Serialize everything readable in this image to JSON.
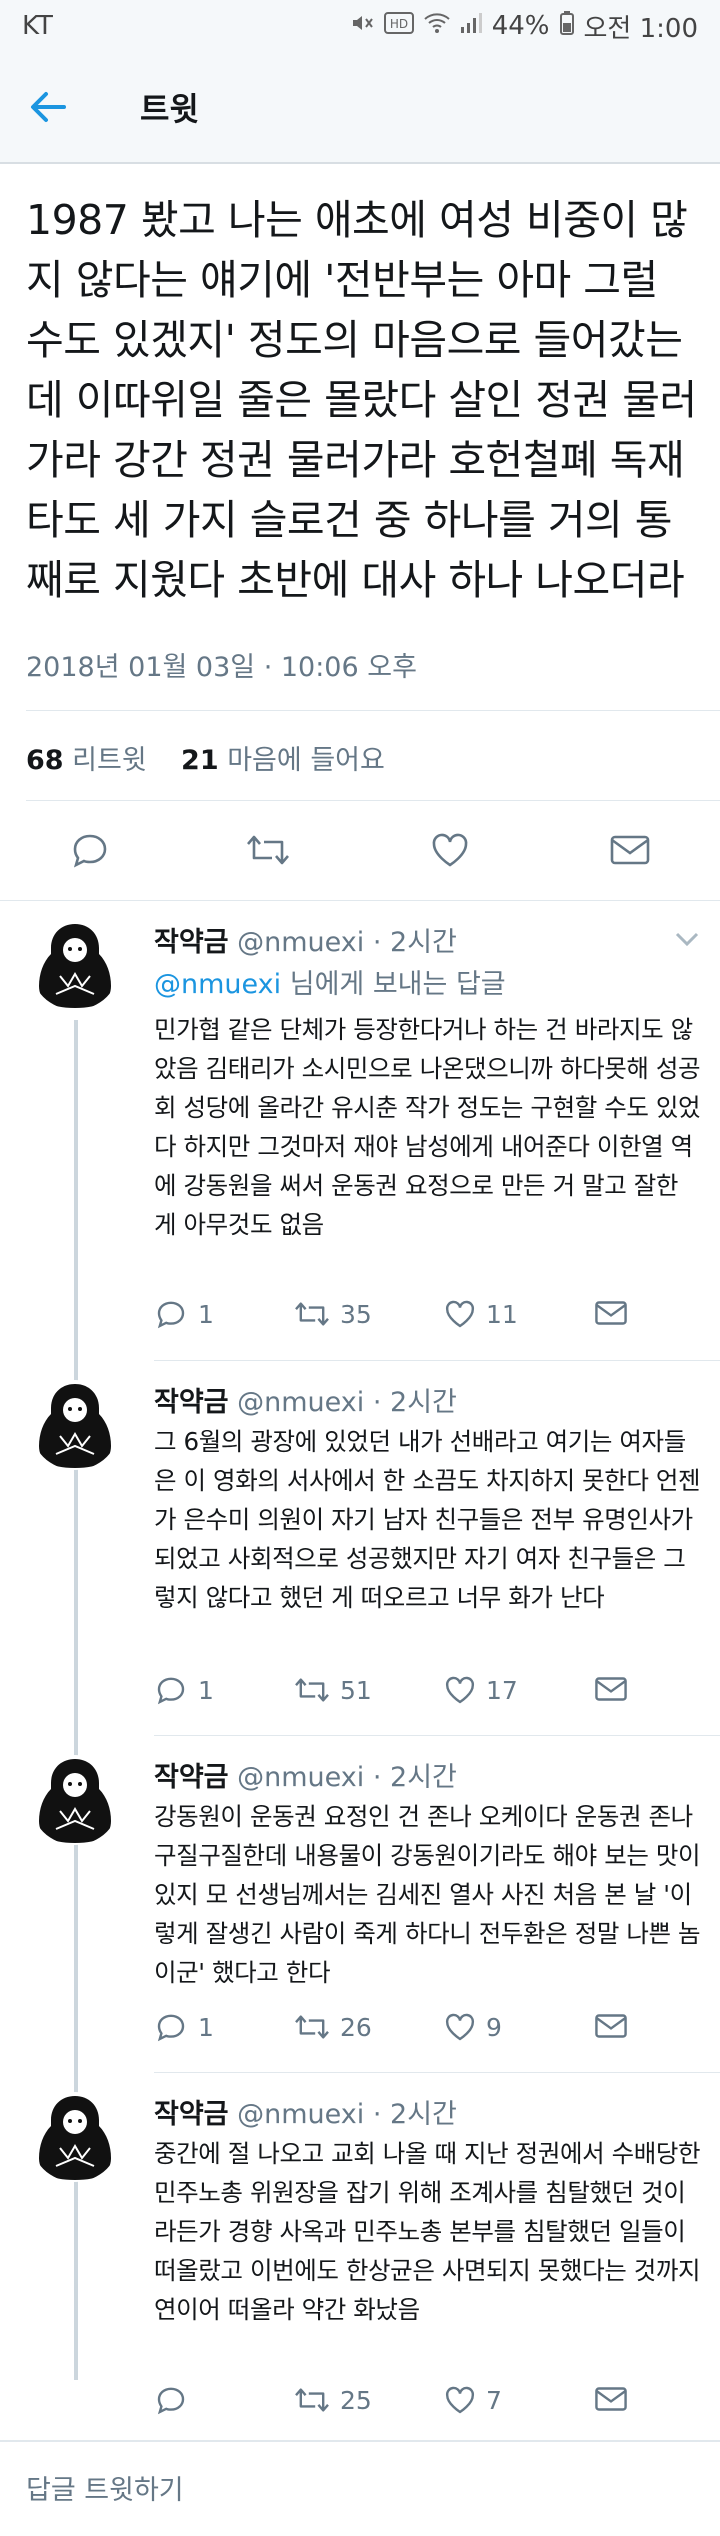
{
  "status_bar": {
    "carrier": "KT",
    "battery": "44%",
    "time": "오전 1:00",
    "icons": [
      "mute-icon",
      "hd-icon",
      "wifi-icon",
      "signal-icon",
      "battery-icon"
    ]
  },
  "header": {
    "back_icon": "arrow-left-icon",
    "title": "트윗"
  },
  "tweet": {
    "text": "1987 봤고 나는 애초에 여성 비중이 많지 않다는 얘기에 '전반부는 아마 그럴 수도 있겠지' 정도의 마음으로 들어갔는데 이따위일 줄은 몰랐다 살인 정권 물러가라 강간 정권 물러가라 호헌철폐 독재 타도 세 가지 슬로건 중 하나를 거의 통째로 지웠다 초반에 대사 하나 나오더라",
    "timestamp": "2018년 01월 03일 · 10:06 오후",
    "retweets_count": "68",
    "retweets_label": "리트윗",
    "likes_count": "21",
    "likes_label": "마음에 들어요"
  },
  "replies": [
    {
      "name": "작약금",
      "handle": "@nmuexi · 2시간",
      "to_mention": "@nmuexi",
      "to_suffix": " 님에게 보내는 답글",
      "text": "민가협 같은 단체가 등장한다거나 하는 건 바라지도 않았음 김태리가 소시민으로 나온댔으니까 하다못해 성공회 성당에 올라간 유시춘 작가 정도는 구현할 수도 있었다 하지만 그것마저 재야 남성에게 내어준다 이한열 역에 강동원을 써서 운동권 요정으로 만든 거 말고 잘한 게 아무것도 없음",
      "replies": "1",
      "retweets": "35",
      "likes": "11"
    },
    {
      "name": "작약금",
      "handle": "@nmuexi · 2시간",
      "text": "그 6월의 광장에 있었던 내가 선배라고 여기는 여자들은 이 영화의 서사에서 한 소끔도 차지하지 못한다 언젠가 은수미 의원이 자기 남자 친구들은 전부 유명인사가 되었고 사회적으로 성공했지만 자기 여자 친구들은 그렇지 않다고 했던 게 떠오르고 너무 화가 난다",
      "replies": "1",
      "retweets": "51",
      "likes": "17"
    },
    {
      "name": "작약금",
      "handle": "@nmuexi · 2시간",
      "text": "강동원이 운동권 요정인 건 존나 오케이다 운동권 존나 구질구질한데 내용물이 강동원이기라도 해야 보는 맛이 있지 모 선생님께서는 김세진 열사 사진 처음 본 날 '이렇게 잘생긴 사람이 죽게 하다니 전두환은 정말 나쁜 놈이군' 했다고 한다",
      "replies": "1",
      "retweets": "26",
      "likes": "9"
    },
    {
      "name": "작약금",
      "handle": "@nmuexi · 2시간",
      "text": "중간에 절 나오고 교회 나올 때 지난 정권에서 수배당한 민주노총 위원장을 잡기 위해 조계사를 침탈했던 것이라든가 경향 사옥과 민주노총 본부를 침탈했던 일들이 떠올랐고 이번에도 한상균은 사면되지 못했다는 것까지 연이어 떠올라 약간 화났음",
      "replies": "",
      "retweets": "25",
      "likes": "7"
    }
  ],
  "bottom_bar": {
    "placeholder": "답글 트윗하기"
  }
}
